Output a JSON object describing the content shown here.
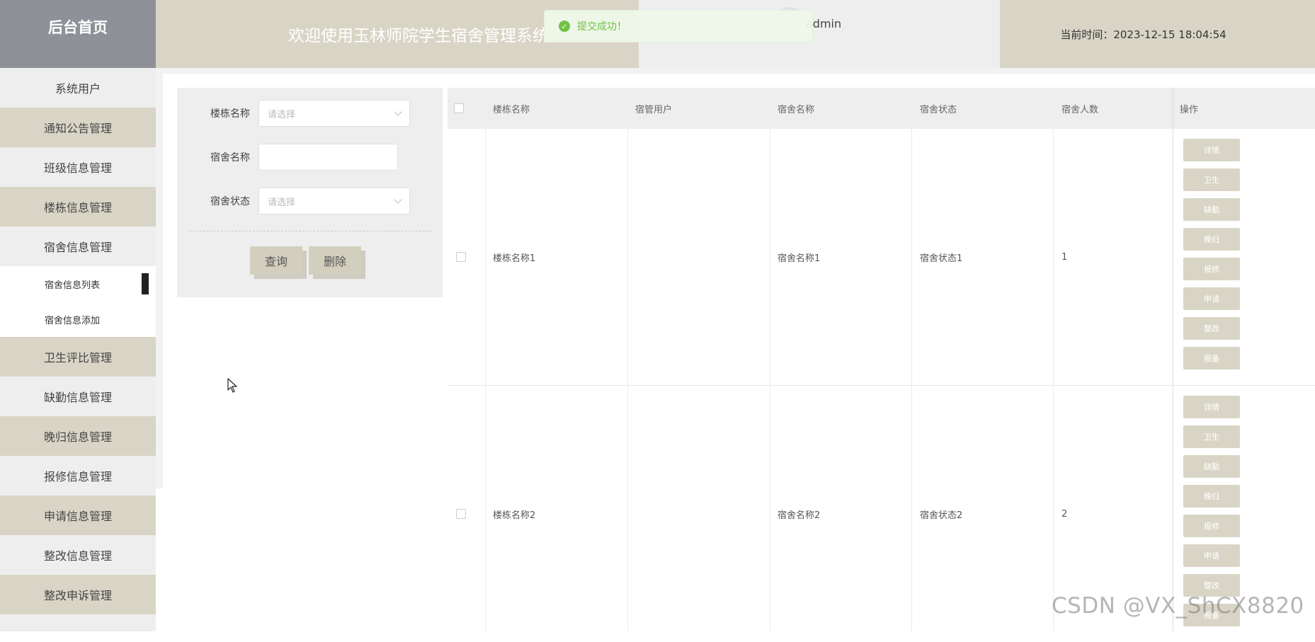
{
  "brand": {
    "title": "后台首页"
  },
  "header": {
    "title": "欢迎使用玉林师院学生宿舍管理系统",
    "user": "admin",
    "time": "当前时间：2023-12-15 18:04:54"
  },
  "toast": {
    "message": "提交成功！"
  },
  "sidebar": {
    "items": [
      {
        "label": "系统用户"
      },
      {
        "label": "通知公告管理"
      },
      {
        "label": "班级信息管理"
      },
      {
        "label": "楼栋信息管理"
      },
      {
        "label": "宿舍信息管理"
      },
      {
        "label": "宿舍信息列表"
      },
      {
        "label": "宿舍信息添加"
      },
      {
        "label": "卫生评比管理"
      },
      {
        "label": "缺勤信息管理"
      },
      {
        "label": "晚归信息管理"
      },
      {
        "label": "报修信息管理"
      },
      {
        "label": "申请信息管理"
      },
      {
        "label": "整改信息管理"
      },
      {
        "label": "整改申诉管理"
      }
    ]
  },
  "search": {
    "building_label": "楼栋名称",
    "building_placeholder": "请选择",
    "room_label": "宿舍名称",
    "room_value": "",
    "status_label": "宿舍状态",
    "status_placeholder": "请选择",
    "query_button": "查询",
    "delete_button": "删除"
  },
  "table": {
    "headers": [
      "楼栋名称",
      "宿管用户",
      "宿舍名称",
      "宿舍状态",
      "宿舍人数",
      "操作"
    ],
    "rows": [
      {
        "building": "楼栋名称1",
        "manager": "",
        "room": "宿舍名称1",
        "status": "宿舍状态1",
        "count": "1"
      },
      {
        "building": "楼栋名称2",
        "manager": "",
        "room": "宿舍名称2",
        "status": "宿舍状态2",
        "count": "2"
      }
    ],
    "actions": [
      "详情",
      "卫生",
      "缺勤",
      "晚归",
      "报修",
      "申请",
      "整改",
      "报备"
    ]
  },
  "watermark": "CSDN @VX_ShCX8820",
  "colors": {
    "accent": "#d9d5c6",
    "brand_bg": "#8e9197",
    "success": "#67c23a"
  }
}
